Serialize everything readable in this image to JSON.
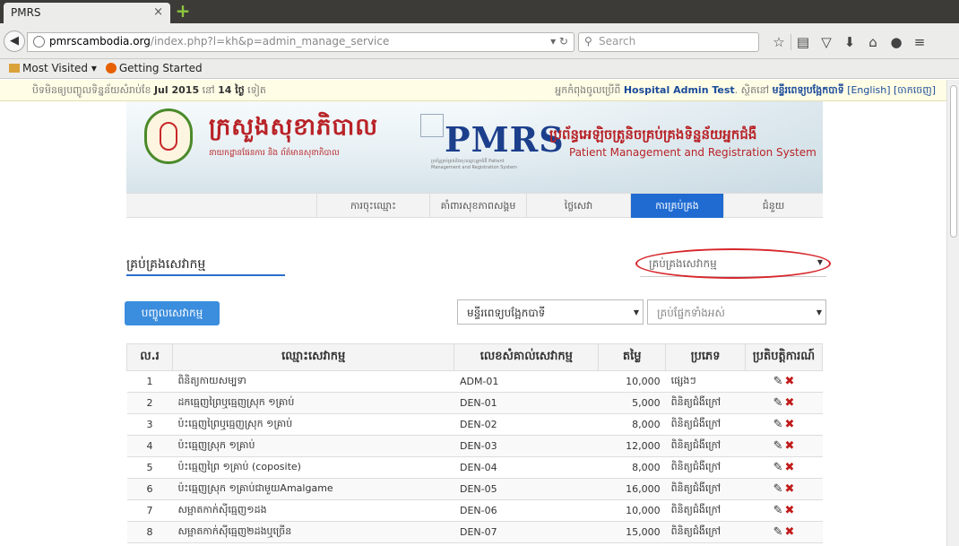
{
  "browser": {
    "tab_title": "PMRS",
    "tab_close": "×",
    "new_tab": "+",
    "url_host": "pmrscambodia.org",
    "url_path": "/index.php?l=kh&p=admin_manage_service",
    "search_placeholder": "Search",
    "bookmarks": [
      "Most Visited ▾",
      "Getting Started"
    ]
  },
  "info_bar": {
    "prefix": "បិទមិនឲ្យបញ្ចូលទិន្នន័យសំរាប់ខែ ",
    "month": "Jul 2015",
    "middle": " នៅ ",
    "days": "14 ថ្ងៃ",
    "suffix": " ទៀត",
    "login_prefix": "អ្នកកំពុងចូលប្រើពី ",
    "user": "Hospital Admin Test",
    "location_prefix": ". ស្ថិតនៅ ",
    "hospital": "មន្ទីរពេទ្យបង្អែកបាទី",
    "lang_link": "[English]",
    "logout_link": "[ចាកចេញ]"
  },
  "banner": {
    "ministry_title": "ក្រសួងសុខាភិបាល",
    "ministry_subtitle": "នាយកដ្ឋានផែនការ និង ព័ត៌មានសុខាភិបាល",
    "pmrs_logo": "PMRS",
    "pmrs_tagline": "ប្រព័ន្ធគ្រប់គ្រងនិងចុះឈ្មោះអ្នកជំងឺ Patient Management and Registration System",
    "system_kh": "ប្រព័ន្ធអេឡិចត្រូនិចគ្រប់គ្រងទិន្នន័យអ្នកជំងឺ",
    "system_en": "Patient Management and Registration System"
  },
  "menu": [
    {
      "label": "ការចុះឈ្មោះ"
    },
    {
      "label": "គាំពារសុខភាពសង្គម"
    },
    {
      "label": "ថ្លៃសេវា"
    },
    {
      "label": "ការគ្រប់គ្រង"
    },
    {
      "label": "ជំនួយ"
    }
  ],
  "active_menu": "ការគ្រប់គ្រង",
  "section": {
    "title": "គ្រប់គ្រងសេវាកម្ម",
    "filter_value": "គ្រប់គ្រងសេវាកម្ម",
    "add_button": "បញ្ចូលសេវាកម្ម",
    "hospital_select": "មន្ទីរពេទ្យបង្អែកបាទី",
    "department_select": "គ្រប់ផ្នែកទាំងអស់"
  },
  "table": {
    "headers": [
      "ល.រ",
      "ឈ្មោះសេវាកម្ម",
      "លេខសំគាល់សេវាកម្ម",
      "តម្លៃ",
      "ប្រភេទ",
      "ប្រតិបត្តិការណ៍"
    ],
    "rows": [
      {
        "no": "1",
        "name": "ពិនិត្យកាយសម្បទា",
        "code": "ADM-01",
        "price": "10,000",
        "type": "ផ្សេងៗ"
      },
      {
        "no": "2",
        "name": "ដកធ្មេញព្រៃឬធ្មេញស្រុក ១គ្រាប់",
        "code": "DEN-01",
        "price": "5,000",
        "type": "ពិនិត្យជំងឺក្រៅ"
      },
      {
        "no": "3",
        "name": "ប៉ះធ្មេញព្រៃឬធ្មេញស្រុក ១គ្រាប់",
        "code": "DEN-02",
        "price": "8,000",
        "type": "ពិនិត្យជំងឺក្រៅ"
      },
      {
        "no": "4",
        "name": "ប៉ះធ្មេញស្រុក ១គ្រាប់",
        "code": "DEN-03",
        "price": "12,000",
        "type": "ពិនិត្យជំងឺក្រៅ"
      },
      {
        "no": "5",
        "name": "ប៉ះធ្មេញព្រៃ ១គ្រាប់ (coposite)",
        "code": "DEN-04",
        "price": "8,000",
        "type": "ពិនិត្យជំងឺក្រៅ"
      },
      {
        "no": "6",
        "name": "ប៉ះធ្មេញស្រុក ១គ្រាប់ជាមួយAmalgame",
        "code": "DEN-05",
        "price": "16,000",
        "type": "ពិនិត្យជំងឺក្រៅ"
      },
      {
        "no": "7",
        "name": "សម្អាតកាក់ស៊ីធ្មេញ១ដង",
        "code": "DEN-06",
        "price": "10,000",
        "type": "ពិនិត្យជំងឺក្រៅ"
      },
      {
        "no": "8",
        "name": "សម្អាតកាក់ស៊ីធ្មេញ២ដងឬច្រើន",
        "code": "DEN-07",
        "price": "15,000",
        "type": "ពិនិត្យជំងឺក្រៅ"
      }
    ]
  },
  "icons": {
    "edit": "✎",
    "delete": "✖"
  },
  "colors": {
    "accent": "#1f6bd2",
    "brand_red": "#b82226",
    "button_blue": "#3b8ddd",
    "delete_red": "#c21a1a"
  }
}
